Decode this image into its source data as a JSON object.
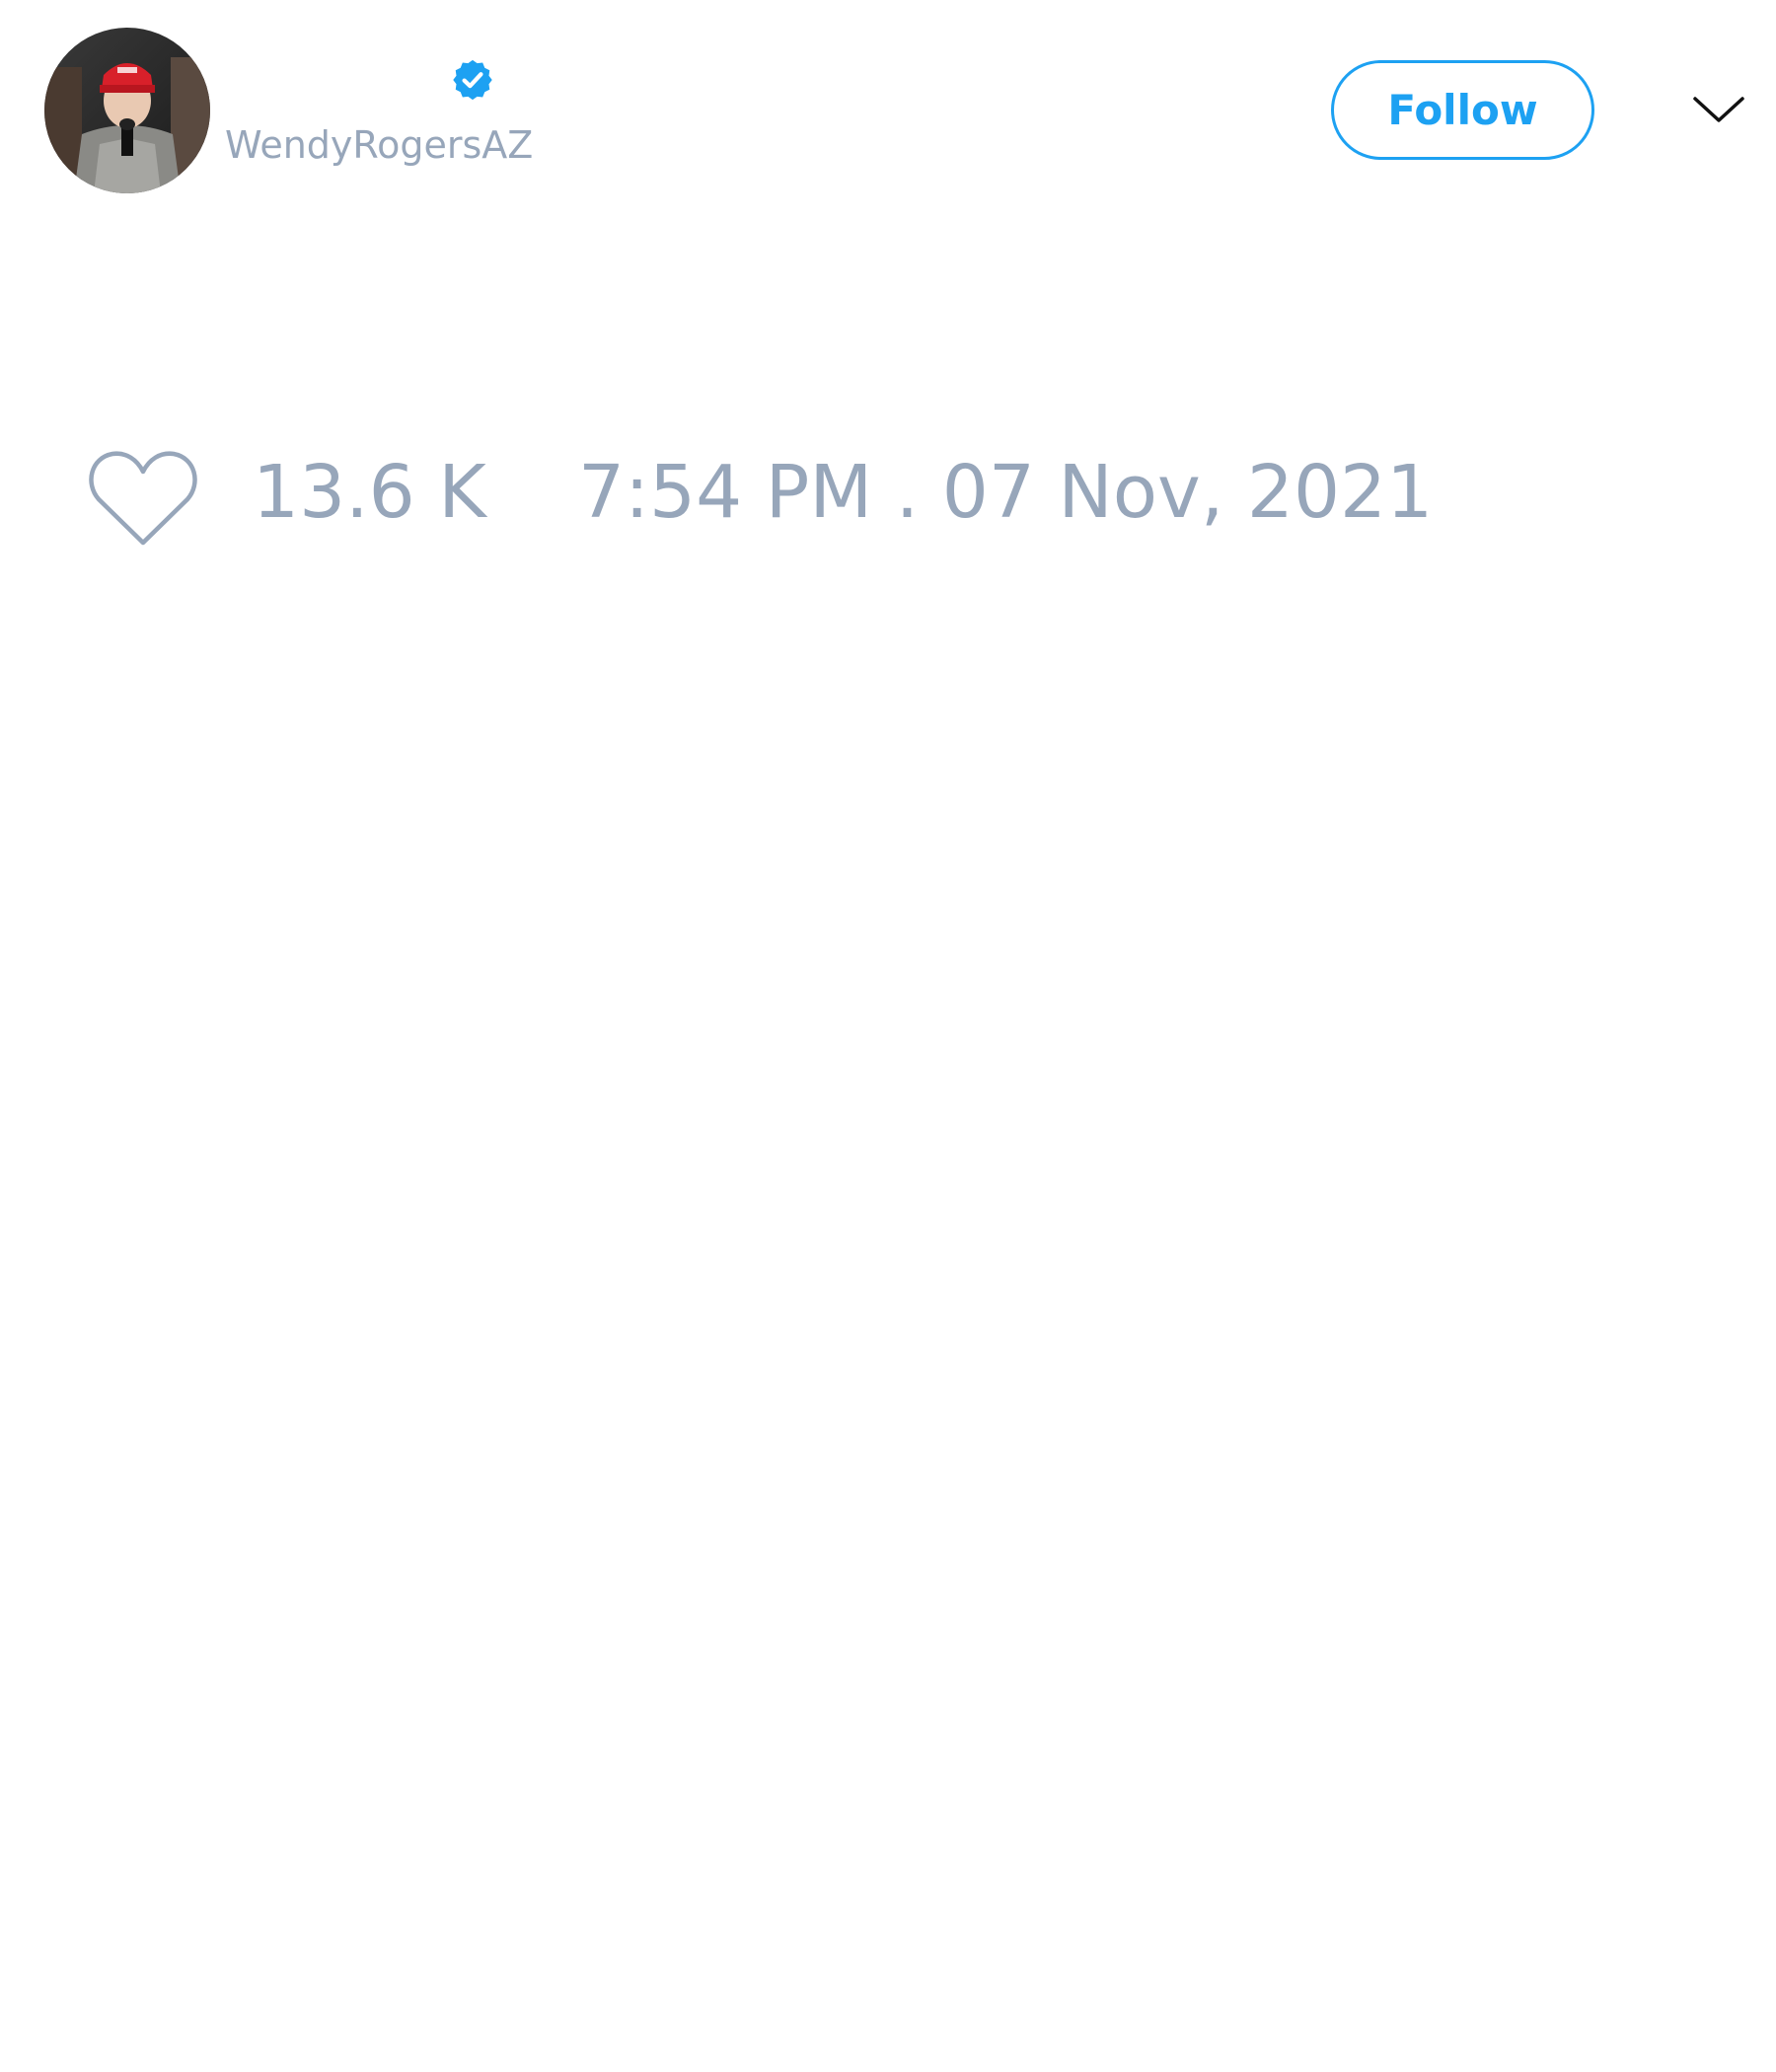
{
  "tweet": {
    "author": {
      "handle": "WendyRogersAZ",
      "verified": true,
      "avatar": "profile-photo"
    },
    "follow_label": "Follow",
    "menu_icon": "chevron-down-icon",
    "likes": {
      "icon": "heart-outline-icon",
      "count": "13.6 K"
    },
    "timestamp": "7:54 PM . 07 Nov, 2021"
  },
  "colors": {
    "accent": "#1da1f2",
    "muted_text": "#97a6ba",
    "background": "#ffffff"
  }
}
